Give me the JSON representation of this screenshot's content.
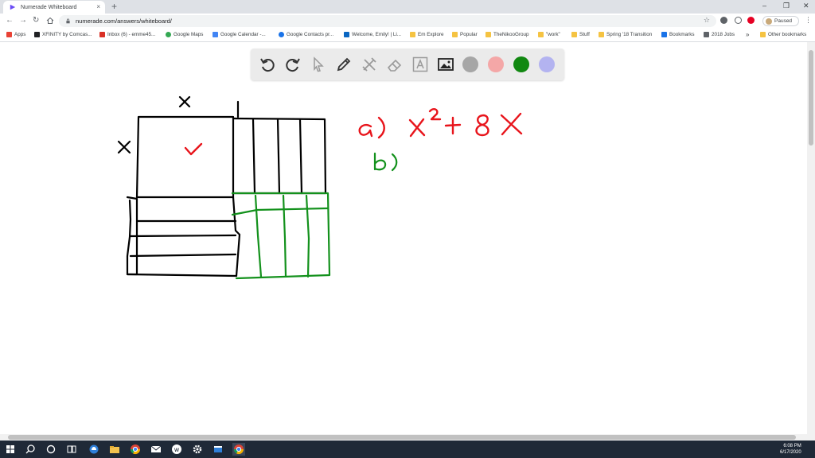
{
  "browser": {
    "tab_title": "Numerade Whiteboard",
    "close_glyph": "×",
    "newtab_glyph": "+",
    "window_controls": [
      "–",
      "❐",
      "✕"
    ],
    "url": "numerade.com/answers/whiteboard/",
    "profile_label": "Paused"
  },
  "bookmarks": [
    {
      "label": "Apps",
      "icon": "apps-grid-icon",
      "color": "#e94235"
    },
    {
      "label": "XFINITY by Comcas...",
      "icon": "xfinity-icon",
      "color": "#202124"
    },
    {
      "label": "Inbox (6) - emme45...",
      "icon": "gmail-icon",
      "color": "#d93025"
    },
    {
      "label": "Google Maps",
      "icon": "maps-pin-icon",
      "color": "#34a853"
    },
    {
      "label": "Google Calendar -...",
      "icon": "calendar-icon",
      "color": "#4285f4"
    },
    {
      "label": "Google Contacts pr...",
      "icon": "contacts-icon",
      "color": "#1a73e8"
    },
    {
      "label": "Welcome, Emily! | Li...",
      "icon": "linkedin-icon",
      "color": "#0a66c2"
    },
    {
      "label": "Em Explore",
      "icon": "folder-icon",
      "color": "#f5c342"
    },
    {
      "label": "Popular",
      "icon": "folder-icon",
      "color": "#f5c342"
    },
    {
      "label": "TheNikooGroup",
      "icon": "folder-icon",
      "color": "#f5c342"
    },
    {
      "label": "\"work\"",
      "icon": "folder-icon",
      "color": "#f5c342"
    },
    {
      "label": "Stuff",
      "icon": "folder-icon",
      "color": "#f5c342"
    },
    {
      "label": "Spring '18 Transition",
      "icon": "folder-icon",
      "color": "#f5c342"
    },
    {
      "label": "Bookmarks",
      "icon": "star-icon",
      "color": "#1a73e8"
    },
    {
      "label": "2018 Jobs",
      "icon": "jobs-icon",
      "color": "#5f6368"
    }
  ],
  "bookmarks_overflow": "»",
  "other_bookmarks": "Other bookmarks",
  "toolbar": {
    "tools": [
      "undo-icon",
      "redo-icon",
      "select-cursor-icon",
      "pen-icon",
      "tools-icon",
      "eraser-icon",
      "text-icon",
      "image-icon"
    ],
    "colors": [
      "#a6a6a6",
      "#f4a7a7",
      "#118811",
      "#b3b3f0"
    ]
  },
  "whiteboard": {
    "ink_black": "#000000",
    "ink_red": "#e8141b",
    "ink_green": "#13911c"
  },
  "taskbar": {
    "time": "6:08 PM",
    "date": "6/17/2020"
  }
}
